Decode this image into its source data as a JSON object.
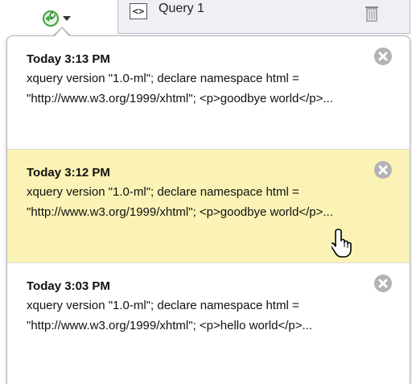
{
  "tab": {
    "label": "Query 1",
    "tag_icon": "<>"
  },
  "icons": {
    "history": "history-globe-icon",
    "dropdown": "caret-down-icon",
    "query_tag": "code-tag-icon",
    "delete": "trash-icon",
    "remove": "close-circle-icon",
    "pointer": "hand-cursor-icon"
  },
  "colors": {
    "highlight": "#fbf3b5",
    "close_button": "#b3b3b3",
    "history_icon": "#3aa33a"
  },
  "history": {
    "entries": [
      {
        "time": "Today 3:13 PM",
        "code": "xquery version \"1.0-ml\"; declare namespace html = \"http://www.w3.org/1999/xhtml\"; <p>goodbye world</p>..."
      },
      {
        "time": "Today 3:12 PM",
        "code": "xquery version \"1.0-ml\"; declare namespace html = \"http://www.w3.org/1999/xhtml\"; <p>goodbye world</p>..."
      },
      {
        "time": "Today 3:03 PM",
        "code": "xquery version \"1.0-ml\"; declare namespace html = \"http://www.w3.org/1999/xhtml\"; <p>hello world</p>..."
      }
    ]
  }
}
